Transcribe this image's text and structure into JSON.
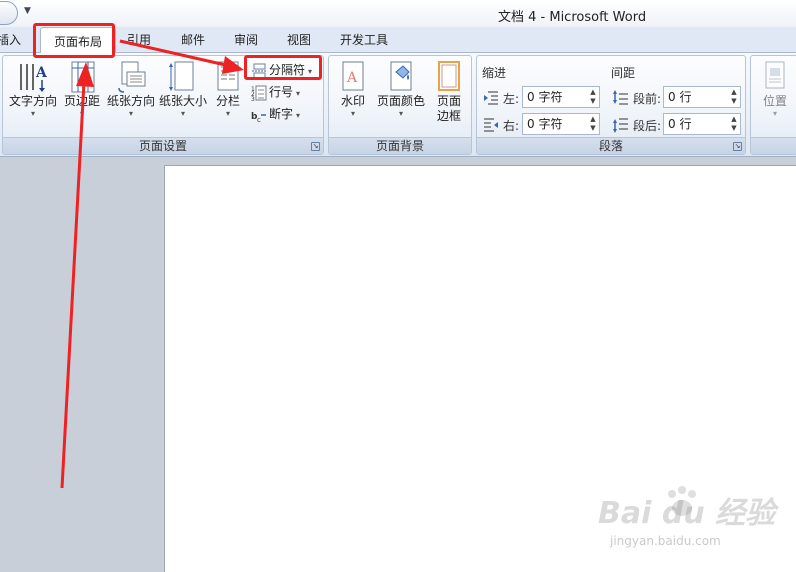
{
  "window": {
    "title": "文档 4 - Microsoft Word"
  },
  "tabs": [
    {
      "label": "插入"
    },
    {
      "label": "页面布局",
      "active": true
    },
    {
      "label": "引用"
    },
    {
      "label": "邮件"
    },
    {
      "label": "审阅"
    },
    {
      "label": "视图"
    },
    {
      "label": "开发工具"
    }
  ],
  "groups": {
    "page_setup": {
      "label": "页面设置",
      "text_direction": "文字方向",
      "margins": "页边距",
      "orientation": "纸张方向",
      "size": "纸张大小",
      "columns": "分栏",
      "breaks": "分隔符",
      "line_numbers": "行号",
      "hyphenation": "断字"
    },
    "page_background": {
      "label": "页面背景",
      "watermark": "水印",
      "page_color": "页面颜色",
      "page_borders_line1": "页面",
      "page_borders_line2": "边框"
    },
    "paragraph": {
      "label": "段落",
      "indent_title": "缩进",
      "indent_left_label": "左:",
      "indent_left_value": "0 字符",
      "indent_right_label": "右:",
      "indent_right_value": "0 字符",
      "spacing_title": "间距",
      "spacing_before_label": "段前:",
      "spacing_before_value": "0 行",
      "spacing_after_label": "段后:",
      "spacing_after_value": "0 行"
    },
    "arrange": {
      "position": "位置"
    }
  },
  "watermark": {
    "brand": "Bai du 经验",
    "url": "jingyan.baidu.com"
  },
  "colors": {
    "highlight": "#ee2222",
    "ribbon": "#eaf0f8",
    "doc_background": "#c9cfd8"
  }
}
